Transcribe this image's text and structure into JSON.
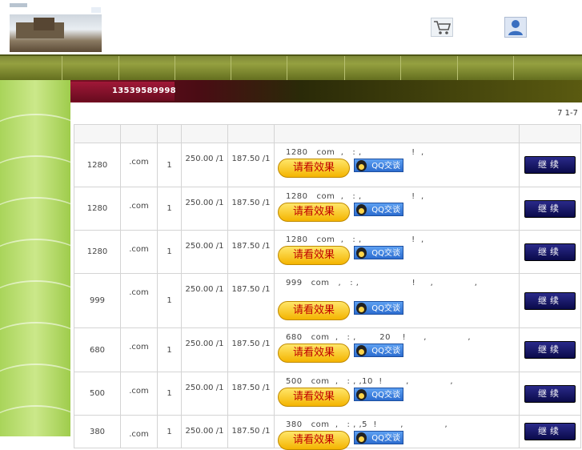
{
  "header": {
    "logo_alt": "",
    "cart_icon": "cart-icon",
    "user_icon": "user-icon"
  },
  "nav": {
    "cells": 10
  },
  "contact": {
    "phone": "13539589998"
  },
  "pager": {
    "text": "7  1-7"
  },
  "table": {
    "effect_label": "请看效果",
    "qq_label": "QQ交谈",
    "continue_label": "继续",
    "rows": [
      {
        "price": "1280",
        "suffix": ".com",
        "qty": "1",
        "p1": "250.00 /1",
        "p2": "187.50 /1",
        "desc": "1280   com  ,   : ,                 !  ,"
      },
      {
        "price": "1280",
        "suffix": ".com",
        "qty": "1",
        "p1": "250.00 /1",
        "p2": "187.50 /1",
        "desc": "1280   com  ,   : ,                 !  ,"
      },
      {
        "price": "1280",
        "suffix": ".com",
        "qty": "1",
        "p1": "250.00 /1",
        "p2": "187.50 /1",
        "desc": "1280   com  ,   : ,                 !  ,"
      },
      {
        "price": "999",
        "suffix": ".com",
        "qty": "1",
        "p1": "250.00 /1",
        "p2": "187.50 /1",
        "desc": "999   com   ,   : ,                  !     ,              ,"
      },
      {
        "price": "680",
        "suffix": ".com",
        "qty": "1",
        "p1": "250.00 /1",
        "p2": "187.50 /1",
        "desc": "680   com  ,   : ,        20    !      ,              ,"
      },
      {
        "price": "500",
        "suffix": ".com",
        "qty": "1",
        "p1": "250.00 /1",
        "p2": "187.50 /1",
        "desc": "500   com  ,   : , ,10  !        ,              ,"
      },
      {
        "price": "380",
        "suffix": ".com",
        "qty": "1",
        "p1": "250.00 /1",
        "p2": "187.50 /1",
        "desc": "380   com  ,   : , ,5  !        ,              ,"
      }
    ]
  }
}
